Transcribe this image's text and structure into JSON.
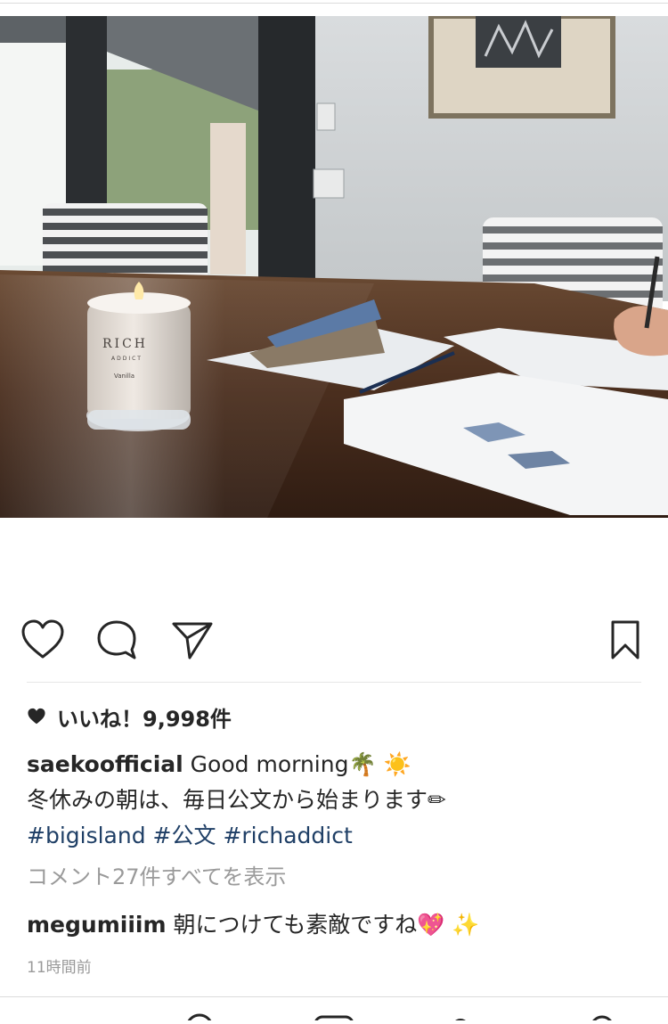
{
  "post": {
    "image_alt": "Candle and papers on wooden table",
    "candle_brand": "RICH",
    "candle_sub": "ADDICT",
    "candle_scent": "Vanilla",
    "likes_text": "いいね！9,998件",
    "author": "saekoofficial",
    "caption_line1": " Good morning",
    "caption_emoji1": "🌴",
    "caption_emoji2": "☀️",
    "caption_line2": "冬休みの朝は、毎日公文から始まります✏",
    "hashtags": [
      "#bigisland",
      "#公文",
      "#richaddict"
    ],
    "view_comments": "コメント27件すべてを表示",
    "comment": {
      "user": "megumiiim",
      "text": " 朝につけても素敵ですね",
      "emoji1": "💖",
      "emoji2": "✨"
    },
    "timestamp": "11時間前"
  },
  "icons": {
    "like": "heart-outline-icon",
    "comment": "comment-bubble-icon",
    "share": "paper-plane-icon",
    "save": "bookmark-icon",
    "likes_heart": "heart-filled-icon"
  },
  "colors": {
    "text": "#262626",
    "muted": "#9a9a9a",
    "hashtag": "#1f3f66"
  }
}
